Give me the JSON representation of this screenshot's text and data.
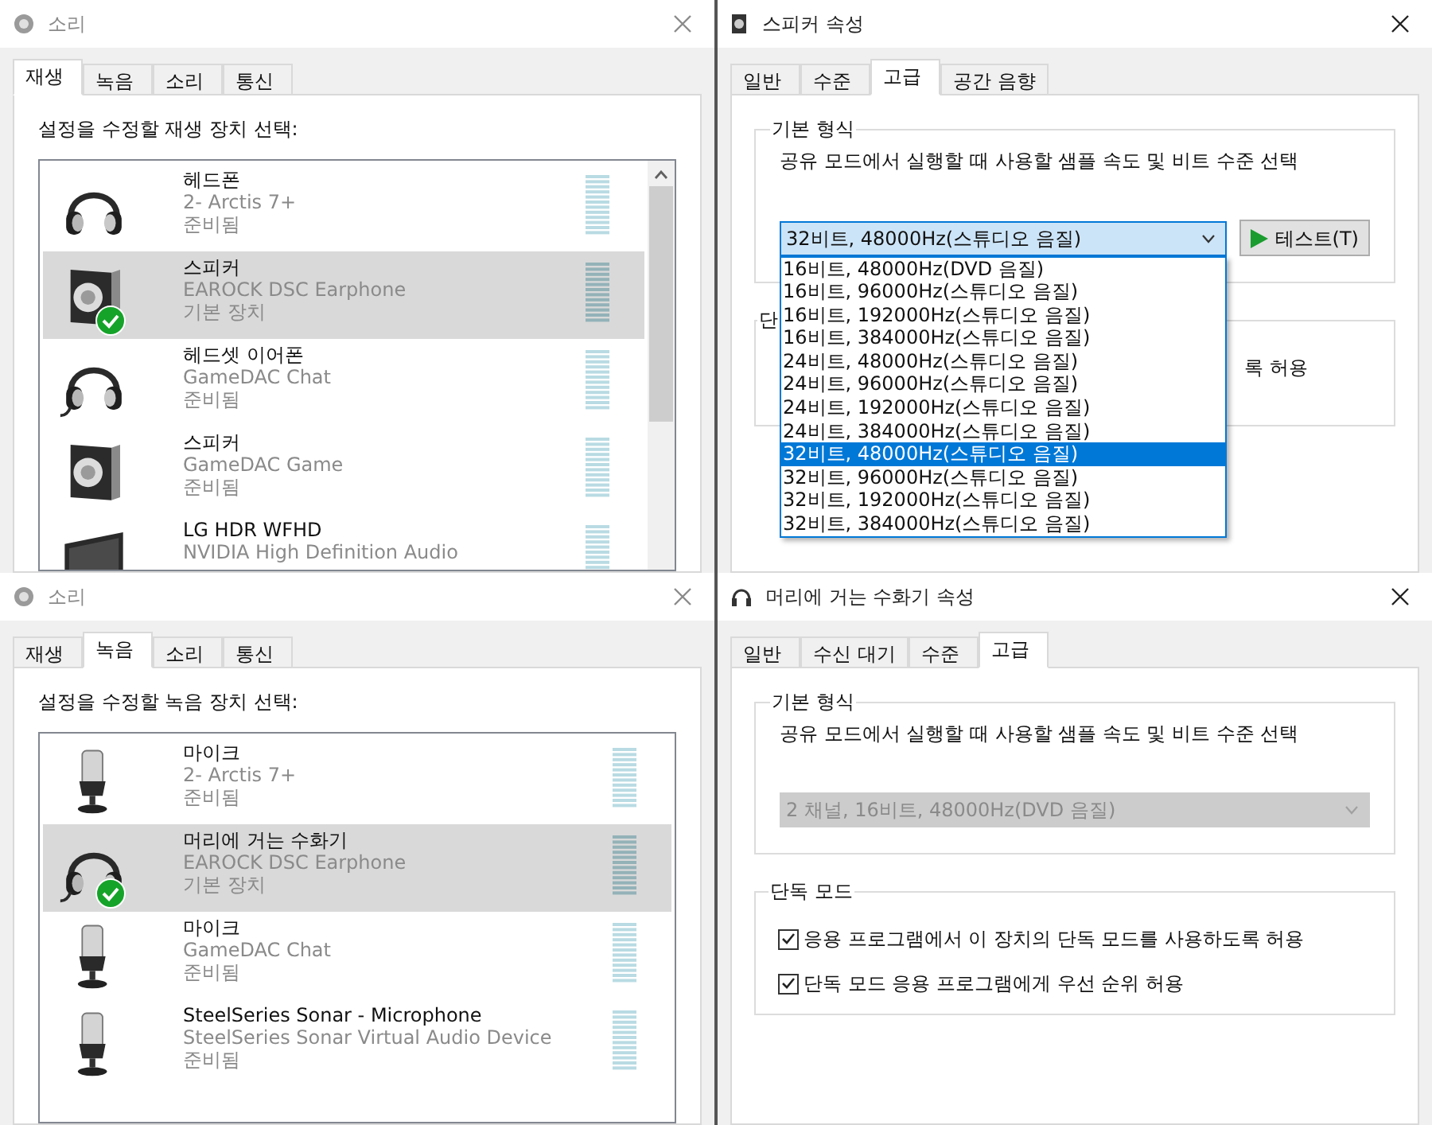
{
  "windows": [
    {
      "kind": "sound",
      "title": "소리",
      "tabs": [
        {
          "label": "재생",
          "selected": true
        },
        {
          "label": "녹음",
          "selected": false
        },
        {
          "label": "소리",
          "selected": false
        },
        {
          "label": "통신",
          "selected": false
        }
      ],
      "prompt": "설정을 수정할 재생 장치 선택:",
      "scrollable": true,
      "devices": [
        {
          "kind": "headphones",
          "name": "헤드폰",
          "detail": "2- Arctis 7+",
          "status": "준비됨",
          "selected": false,
          "default": false
        },
        {
          "kind": "speaker",
          "name": "스피커",
          "detail": "EAROCK DSC Earphone",
          "status": "기본 장치",
          "selected": true,
          "default": true
        },
        {
          "kind": "headset",
          "name": "헤드셋 이어폰",
          "detail": "GameDAC Chat",
          "status": "준비됨",
          "selected": false,
          "default": false
        },
        {
          "kind": "speaker",
          "name": "스피커",
          "detail": "GameDAC Game",
          "status": "준비됨",
          "selected": false,
          "default": false
        },
        {
          "kind": "monitor",
          "name": "LG HDR WFHD",
          "detail": "NVIDIA High Definition Audio",
          "selected": false,
          "default": false
        }
      ]
    },
    {
      "kind": "properties",
      "title": "스피커 속성",
      "tabs": [
        {
          "label": "일반",
          "selected": false
        },
        {
          "label": "수준",
          "selected": false
        },
        {
          "label": "고급",
          "selected": true
        },
        {
          "label": "공간 음향",
          "selected": false
        }
      ],
      "groups": [
        {
          "kind": "format",
          "legend": "기본 형식",
          "description": "공유 모드에서 실행할 때 사용할 샘플 속도 및 비트 수준 선택",
          "value": "32비트, 48000Hz(스튜디오 음질)",
          "disabled": false,
          "test_button": "테스트(T)",
          "options": [
            {
              "label": "16비트, 48000Hz(DVD 음질)",
              "selected": false
            },
            {
              "label": "16비트, 96000Hz(스튜디오 음질)",
              "selected": false
            },
            {
              "label": "16비트, 192000Hz(스튜디오 음질)",
              "selected": false
            },
            {
              "label": "16비트, 384000Hz(스튜디오 음질)",
              "selected": false
            },
            {
              "label": "24비트, 48000Hz(스튜디오 음질)",
              "selected": false
            },
            {
              "label": "24비트, 96000Hz(스튜디오 음질)",
              "selected": false
            },
            {
              "label": "24비트, 192000Hz(스튜디오 음질)",
              "selected": false
            },
            {
              "label": "24비트, 384000Hz(스튜디오 음질)",
              "selected": false
            },
            {
              "label": "32비트, 48000Hz(스튜디오 음질)",
              "selected": true
            },
            {
              "label": "32비트, 96000Hz(스튜디오 음질)",
              "selected": false
            },
            {
              "label": "32비트, 192000Hz(스튜디오 음질)",
              "selected": false
            },
            {
              "label": "32비트, 384000Hz(스튜디오 음질)",
              "selected": false
            }
          ]
        },
        {
          "kind": "covered",
          "legend": "단",
          "tail": "록 허용"
        }
      ]
    },
    {
      "kind": "sound",
      "title": "소리",
      "tabs": [
        {
          "label": "재생",
          "selected": false
        },
        {
          "label": "녹음",
          "selected": true
        },
        {
          "label": "소리",
          "selected": false
        },
        {
          "label": "통신",
          "selected": false
        }
      ],
      "prompt": "설정을 수정할 녹음 장치 선택:",
      "scrollable": false,
      "devices": [
        {
          "kind": "microphone",
          "name": "마이크",
          "detail": "2- Arctis 7+",
          "status": "준비됨",
          "selected": false,
          "default": false
        },
        {
          "kind": "headset",
          "name": "머리에 거는 수화기",
          "detail": "EAROCK DSC Earphone",
          "status": "기본 장치",
          "selected": true,
          "default": true
        },
        {
          "kind": "microphone",
          "name": "마이크",
          "detail": "GameDAC Chat",
          "status": "준비됨",
          "selected": false,
          "default": false
        },
        {
          "kind": "microphone",
          "name": "SteelSeries Sonar - Microphone",
          "detail": "SteelSeries Sonar Virtual Audio Device",
          "status": "준비됨",
          "selected": false,
          "default": false
        }
      ]
    },
    {
      "kind": "properties",
      "title": "머리에 거는 수화기 속성",
      "tabs": [
        {
          "label": "일반",
          "selected": false
        },
        {
          "label": "수신 대기",
          "selected": false
        },
        {
          "label": "수준",
          "selected": false
        },
        {
          "label": "고급",
          "selected": true
        }
      ],
      "groups": [
        {
          "kind": "format",
          "legend": "기본 형식",
          "description": "공유 모드에서 실행할 때 사용할 샘플 속도 및 비트 수준 선택",
          "value": "2 채널, 16비트, 48000Hz(DVD 음질)",
          "disabled": true
        },
        {
          "kind": "exclusive",
          "legend": "단독 모드",
          "options": [
            {
              "label": "응용 프로그램에서 이 장치의 단독 모드를 사용하도록 허용",
              "checked": true
            },
            {
              "label": "단독 모드 응용 프로그램에게 우선 순위 허용",
              "checked": true
            }
          ]
        }
      ]
    }
  ]
}
